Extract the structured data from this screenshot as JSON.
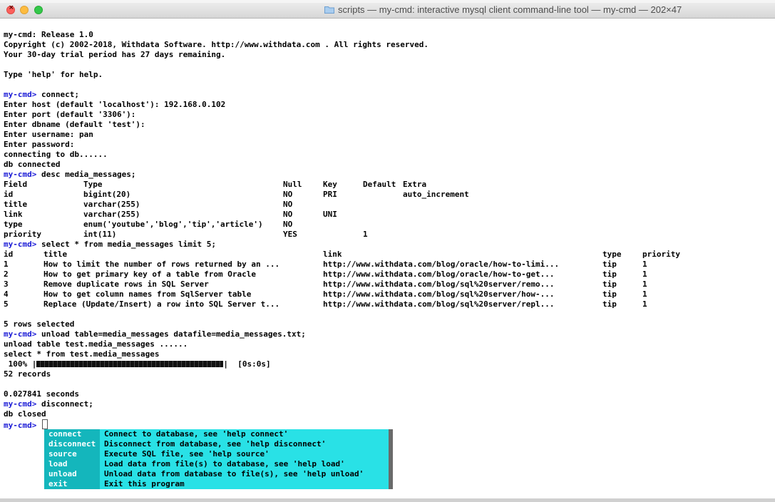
{
  "window": {
    "title": "scripts — my-cmd: interactive mysql client command-line tool — my-cmd — 202×47",
    "folder_icon": "folder-icon"
  },
  "colors": {
    "prompt": "#1a1ad6",
    "completion_bg": "#29e1e6",
    "completion_key_bg": "#14b6bc"
  },
  "session": {
    "prompt": "my-cmd>",
    "banner": [
      "my-cmd: Release 1.0",
      "Copyright (c) 2002-2018, Withdata Software. http://www.withdata.com . All rights reserved.",
      "Your 30-day trial period has 27 days remaining."
    ],
    "help_hint": "Type 'help' for help.",
    "connect_cmd": "connect;",
    "connect_output": [
      "Enter host (default 'localhost'): 192.168.0.102",
      "Enter port (default '3306'):",
      "Enter dbname (default 'test'):",
      "Enter username: pan",
      "Enter password:",
      "connecting to db......",
      "db connected"
    ],
    "desc_cmd": "desc media_messages;",
    "desc_table": {
      "headers": [
        "Field",
        "Type",
        "Null",
        "Key",
        "Default",
        "Extra"
      ],
      "rows": [
        [
          "id",
          "bigint(20)",
          "NO",
          "PRI",
          "",
          "auto_increment"
        ],
        [
          "title",
          "varchar(255)",
          "NO",
          "",
          "",
          ""
        ],
        [
          "link",
          "varchar(255)",
          "NO",
          "UNI",
          "",
          ""
        ],
        [
          "type",
          "enum('youtube','blog','tip','article')",
          "NO",
          "",
          "",
          ""
        ],
        [
          "priority",
          "int(11)",
          "YES",
          "",
          "1",
          ""
        ]
      ]
    },
    "select_cmd": "select * from media_messages limit 5;",
    "select_table": {
      "headers": [
        "id",
        "title",
        "link",
        "type",
        "priority"
      ],
      "rows": [
        [
          "1",
          "How to limit the number of rows returned by an ...",
          "http://www.withdata.com/blog/oracle/how-to-limi...",
          "tip",
          "1"
        ],
        [
          "2",
          "How to get primary key of a table from Oracle",
          "http://www.withdata.com/blog/oracle/how-to-get...",
          "tip",
          "1"
        ],
        [
          "3",
          "Remove duplicate rows in SQL Server",
          "http://www.withdata.com/blog/sql%20server/remo...",
          "tip",
          "1"
        ],
        [
          "4",
          "How to get column names from SqlServer table",
          "http://www.withdata.com/blog/sql%20server/how-...",
          "tip",
          "1"
        ],
        [
          "5",
          "Replace (Update/Insert) a row into SQL Server t...",
          "http://www.withdata.com/blog/sql%20server/repl...",
          "tip",
          "1"
        ]
      ]
    },
    "rows_selected": "5 rows selected",
    "unload_cmd": "unload table=media_messages datafile=media_messages.txt;",
    "unload_output": [
      "unload table test.media_messages ......",
      "select * from test.media_messages"
    ],
    "progress": {
      "percent_label": "100%",
      "value": 1.0,
      "time": "[0s:0s]"
    },
    "records": "52 records",
    "elapsed": "0.027841 seconds",
    "disconnect_cmd": "disconnect;",
    "disconnect_output": "db closed"
  },
  "completion_menu": {
    "items": [
      {
        "key": "connect",
        "desc": "Connect to database, see 'help connect'"
      },
      {
        "key": "disconnect",
        "desc": "Disconnect from database, see 'help disconnect'"
      },
      {
        "key": "source",
        "desc": "Execute SQL file, see 'help source'"
      },
      {
        "key": "load",
        "desc": "Load data from file(s) to database, see 'help load'"
      },
      {
        "key": "unload",
        "desc": "Unload data from database to file(s), see 'help unload'"
      },
      {
        "key": "exit",
        "desc": "Exit this program"
      }
    ]
  }
}
